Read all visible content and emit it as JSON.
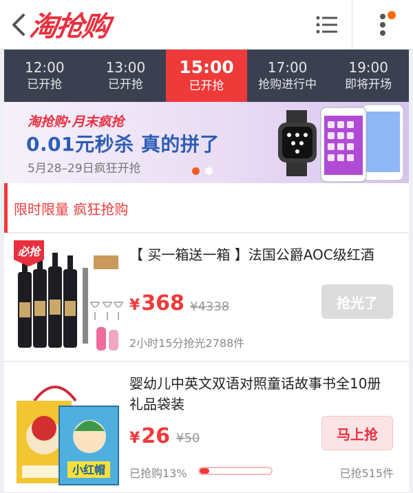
{
  "header": {
    "logo": "淘抢购"
  },
  "tabs": [
    {
      "time": "12:00",
      "status": "已开抢",
      "active": false
    },
    {
      "time": "13:00",
      "status": "已开抢",
      "active": false
    },
    {
      "time": "15:00",
      "status": "已开抢",
      "active": true
    },
    {
      "time": "17:00",
      "status": "抢购进行中",
      "active": false
    },
    {
      "time": "19:00",
      "status": "即将开场",
      "active": false
    }
  ],
  "banner": {
    "subtitle": "淘抢购·月末疯抢",
    "title": "0.01元秒杀 真的拼了",
    "date": "5月28–29日疯狂开抢",
    "active_slide": 1,
    "slide_count": 2
  },
  "section": {
    "title": "限时限量 疯狂抢购"
  },
  "products": [
    {
      "badge": "必抢",
      "title": "【 买一箱送一箱 】法国公爵AOC级红酒",
      "price": "368",
      "currency": "¥",
      "original_price": "¥4338",
      "button": "抢光了",
      "meta": "2小时15分抢光2788件"
    },
    {
      "title": "婴幼儿中英文双语对照童话故事书全10册 礼品袋装",
      "price": "26",
      "currency": "¥",
      "original_price": "¥50",
      "button": "马上抢",
      "progress_label": "已抢购13%",
      "progress": 0.13,
      "sold": "已抢515件",
      "book_label": "小红帽"
    }
  ],
  "colors": {
    "brand_red": "#ef3a3a",
    "tab_bg": "#3a4050",
    "accent_orange": "#f25a22",
    "banner_blue": "#2d5db5"
  }
}
